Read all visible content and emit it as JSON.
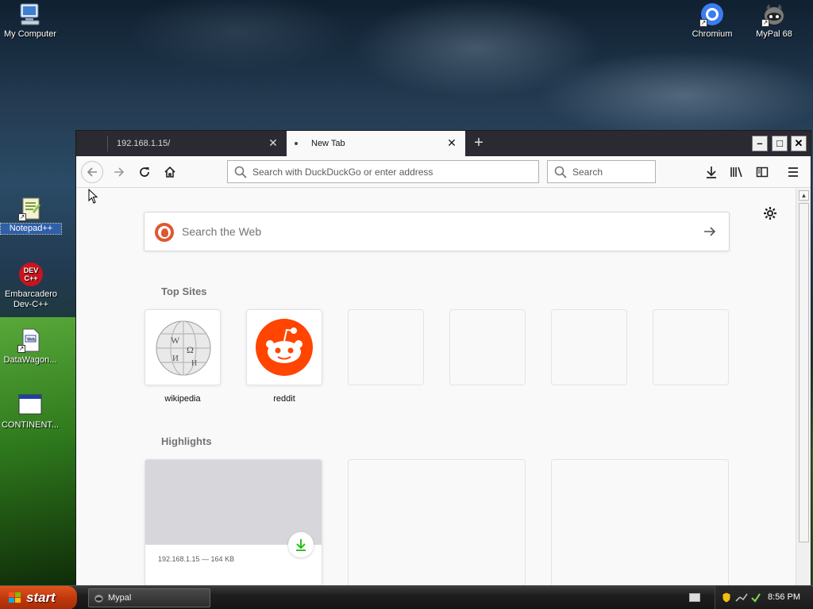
{
  "desktop": {
    "icons": [
      {
        "label": "My Computer"
      },
      {
        "label": "Notepad++"
      },
      {
        "label": "Embarcadero Dev-C++"
      },
      {
        "label": "DataWagon..."
      },
      {
        "label": "CONTINENT..."
      },
      {
        "label": "Chromium"
      },
      {
        "label": "MyPal 68"
      }
    ],
    "devcpp_badge": "DEV C++"
  },
  "browser": {
    "tabs": [
      {
        "title": "192.168.1.15/"
      },
      {
        "title": "New Tab"
      }
    ],
    "newtab_label": "+",
    "close_glyph": "✕",
    "url_placeholder": "Search with DuckDuckGo or enter address",
    "search_placeholder": "Search",
    "window_controls": {
      "minimize": "–",
      "maximize": "□",
      "close": "✕"
    }
  },
  "newtab": {
    "search_placeholder": "Search the Web",
    "top_sites_title": "Top Sites",
    "top_sites": [
      {
        "name": "wikipedia",
        "icon": "wikipedia-globe-icon"
      },
      {
        "name": "reddit",
        "icon": "reddit-alien-icon"
      },
      {
        "name": ""
      },
      {
        "name": ""
      },
      {
        "name": ""
      },
      {
        "name": ""
      }
    ],
    "highlights_title": "Highlights",
    "highlights": [
      {
        "meta": "192.168.1.15 — 164 KB",
        "filename": ""
      },
      {
        "meta": "",
        "filename": ""
      },
      {
        "meta": "",
        "filename": ""
      }
    ]
  },
  "taskbar": {
    "start_label": "start",
    "task_label": "Mypal",
    "clock": "8:56 PM"
  },
  "colors": {
    "reddit_orange": "#ff4500",
    "duckduckgo_orange": "#de5833",
    "start_button": "#c0390c",
    "download_green": "#12bc00"
  }
}
